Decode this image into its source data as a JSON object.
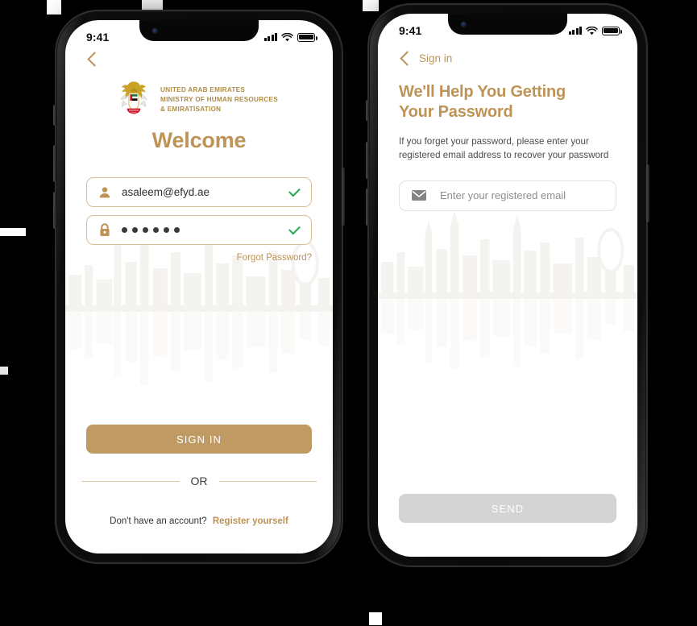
{
  "background_color": "#000000",
  "accent_gold": "#bd9356",
  "button_gold": "#c09a63",
  "disabled_gray": "#d4d4d4",
  "check_green": "#1faa4b",
  "screen_signin": {
    "status_bar": {
      "time": "9:41",
      "signal": "signal-bars",
      "wifi": "wifi-icon",
      "battery": "battery-icon"
    },
    "back_button": "back-chevron",
    "logo": {
      "icon": "uae-falcon-emblem",
      "line1": "UNITED ARAB EMIRATES",
      "line2": "MINISTRY OF HUMAN RESOURCES",
      "line3": "& EMIRATISATION"
    },
    "heading": "Welcome",
    "email_field": {
      "icon": "person-icon",
      "value": "asaleem@efyd.ae",
      "valid_icon": "check-icon"
    },
    "password_field": {
      "icon": "lock-icon",
      "value": "••••••",
      "dot_count": 6,
      "valid_icon": "check-icon"
    },
    "forgot_password": "Forgot Password?",
    "sign_in_button": "SIGN IN",
    "divider": "OR",
    "signup_prompt": "Don't have an account?",
    "signup_link": "Register yourself"
  },
  "screen_forgot": {
    "status_bar": {
      "time": "9:41",
      "signal": "signal-bars",
      "wifi": "wifi-icon",
      "battery": "battery-icon"
    },
    "back_label": "Sign in",
    "title_line1": "We'll Help You Getting",
    "title_line2": "Your Password",
    "description": "If you forget your password, please enter your registered email address to recover your password",
    "email_field": {
      "icon": "envelope-icon",
      "placeholder": "Enter your registered email",
      "value": ""
    },
    "send_button": "SEND"
  }
}
